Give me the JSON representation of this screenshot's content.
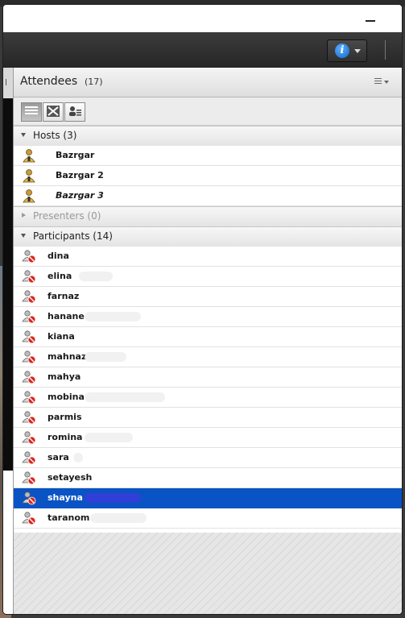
{
  "pod": {
    "title": "Attendees",
    "count": "(17)",
    "menu_icon": "hamburger-menu-icon"
  },
  "toolbar": {
    "info_icon_glyph": "i"
  },
  "view_buttons": [
    "list-view-icon",
    "breakout-view-icon",
    "attendee-status-view-icon"
  ],
  "groups": {
    "hosts": {
      "label": "Hosts (3)",
      "expanded": true
    },
    "presenters": {
      "label": "Presenters (0)",
      "expanded": false
    },
    "participants": {
      "label": "Participants (14)",
      "expanded": true
    }
  },
  "hosts": [
    {
      "name": "Bazrgar"
    },
    {
      "name": "Bazrgar 2"
    },
    {
      "name": "Bazrgar 3"
    }
  ],
  "participants": [
    {
      "name": "dina"
    },
    {
      "name": "elina"
    },
    {
      "name": "farnaz"
    },
    {
      "name": "hanane"
    },
    {
      "name": "kiana"
    },
    {
      "name": "mahnaz"
    },
    {
      "name": "mahya"
    },
    {
      "name": "mobina"
    },
    {
      "name": "parmis"
    },
    {
      "name": "romina"
    },
    {
      "name": "sara"
    },
    {
      "name": "setayesh"
    },
    {
      "name": "shayna"
    },
    {
      "name": "taranom"
    }
  ],
  "colors": {
    "selection": "#0a53c4",
    "toolbar": "#2e2e2e",
    "info_blue": "#1466c8"
  }
}
